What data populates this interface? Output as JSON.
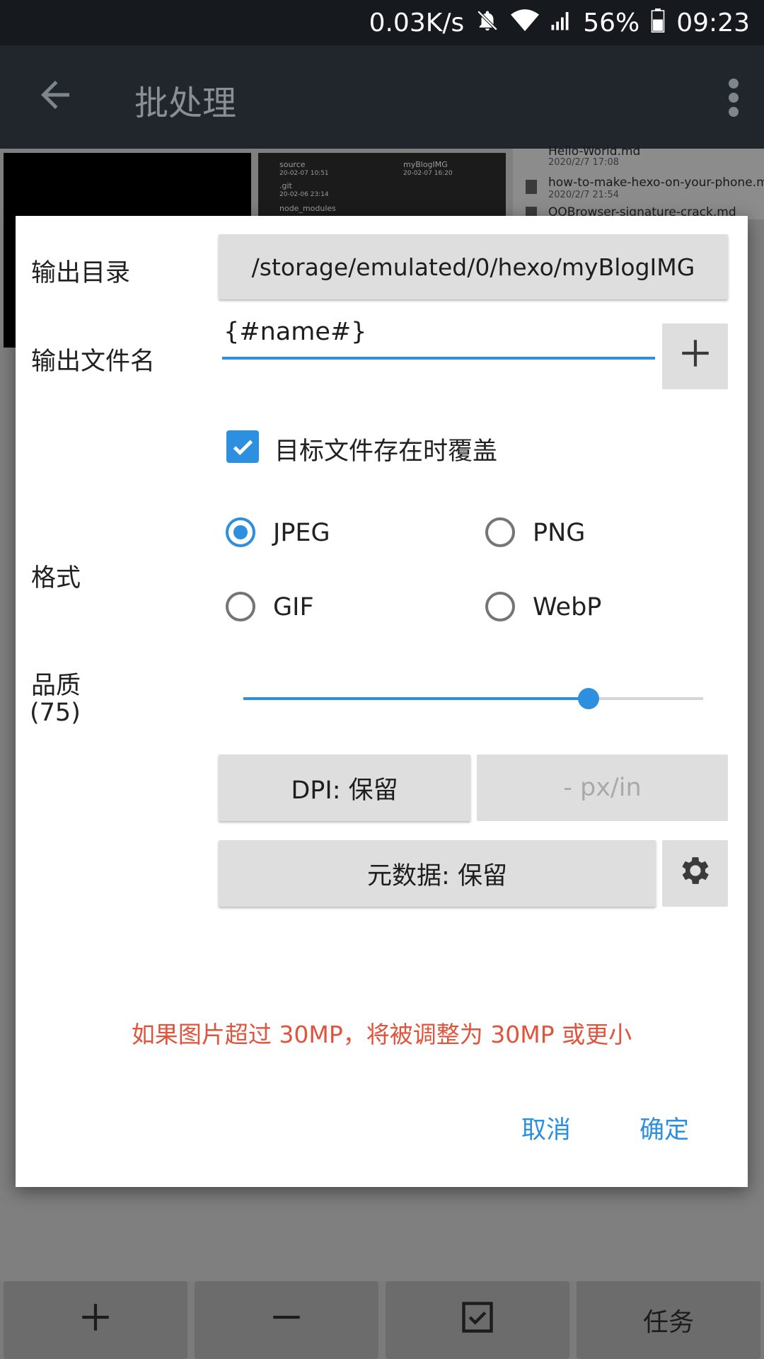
{
  "status_bar": {
    "net_speed": "0.03K/s",
    "battery": "56%",
    "time": "09:23",
    "icons": [
      "bell-muted-icon",
      "wifi-icon",
      "signal-icon",
      "battery-icon"
    ]
  },
  "app_bar": {
    "title": "批处理",
    "back_icon": "arrow-left-icon",
    "menu_icon": "more-vert-icon"
  },
  "background_files": {
    "folders": [
      {
        "name": "source",
        "date": "20-02-07 10:51"
      },
      {
        "name": "myBlogIMG",
        "date": "20-02-07 16:20"
      },
      {
        "name": ".git",
        "date": "20-02-06 23:14"
      },
      {
        "name": "node_modules",
        "date": ""
      }
    ],
    "files": [
      {
        "name": "Hello-World.md",
        "date": "2020/2/7 17:08"
      },
      {
        "name": "how-to-make-hexo-on-your-phone.md",
        "date": "2020/2/7 21:54"
      },
      {
        "name": "QQBrowser-signature-crack.md",
        "date": ""
      }
    ]
  },
  "dialog": {
    "output_dir_label": "输出目录",
    "output_dir_value": "/storage/emulated/0/hexo/myBlogIMG",
    "output_name_label": "输出文件名",
    "output_name_value": "{#name#}",
    "add_icon": "plus-icon",
    "overwrite_checked": true,
    "overwrite_label": "目标文件存在时覆盖",
    "format_label": "格式",
    "formats": [
      {
        "label": "JPEG",
        "selected": true
      },
      {
        "label": "PNG",
        "selected": false
      },
      {
        "label": "GIF",
        "selected": false
      },
      {
        "label": "WebP",
        "selected": false
      }
    ],
    "quality_label": "品质",
    "quality_value": "(75)",
    "quality_level": 75,
    "dpi_button": "DPI: 保留",
    "dpi_input_placeholder": "- px/in",
    "metadata_button": "元数据: 保留",
    "settings_icon": "gear-icon",
    "warning": "如果图片超过 30MP，将被调整为 30MP 或更小",
    "cancel": "取消",
    "confirm": "确定",
    "accent_color": "#2d8fe0",
    "warning_color": "#e0533c"
  },
  "bottom_bar": {
    "add_icon": "plus-icon",
    "remove_icon": "minus-icon",
    "select_icon": "checkbox-icon",
    "tasks": "任务"
  }
}
